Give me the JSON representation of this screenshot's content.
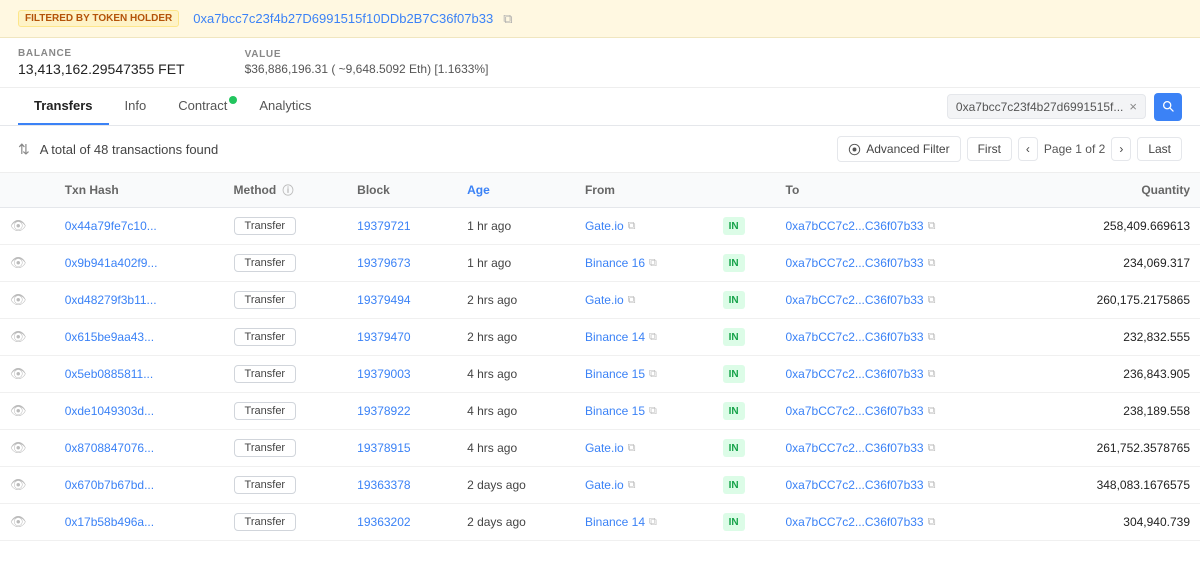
{
  "banner": {
    "tag": "FILTERED BY TOKEN HOLDER",
    "address": "0xa7bcc7c23f4b27D6991515f10DDb2B7C36f07b33",
    "address_short": "0xa7bcc7c23f4b27D6991515f10DDb2B7C36f07b33"
  },
  "stats": {
    "balance_label": "BALANCE",
    "balance_value": "13,413,162.29547355 FET",
    "value_label": "VALUE",
    "value_value": "$36,886,196.31 ( ~9,648.5092 Eth) [1.1633%]"
  },
  "tabs": [
    {
      "id": "transfers",
      "label": "Transfers",
      "active": true,
      "verified": false
    },
    {
      "id": "info",
      "label": "Info",
      "active": false,
      "verified": false
    },
    {
      "id": "contract",
      "label": "Contract",
      "active": false,
      "verified": true
    },
    {
      "id": "analytics",
      "label": "Analytics",
      "active": false,
      "verified": false
    }
  ],
  "address_pill": "0xa7bcc7c23f4b27d6991515f...",
  "filter_bar": {
    "sort_label": "A total of 48 transactions found",
    "advanced_label": "Advanced Filter",
    "first_label": "First",
    "last_label": "Last",
    "page_info": "Page 1 of 2"
  },
  "table": {
    "headers": [
      "",
      "Txn Hash",
      "Method",
      "Block",
      "Age",
      "From",
      "",
      "To",
      "Quantity"
    ],
    "rows": [
      {
        "txn": "0x44a79fe7c10...",
        "method": "Transfer",
        "block": "19379721",
        "age": "1 hr ago",
        "from": "Gate.io",
        "direction": "IN",
        "to": "0xa7bCC7c2...C36f07b33",
        "quantity": "258,409.669613"
      },
      {
        "txn": "0x9b941a402f9...",
        "method": "Transfer",
        "block": "19379673",
        "age": "1 hr ago",
        "from": "Binance 16",
        "direction": "IN",
        "to": "0xa7bCC7c2...C36f07b33",
        "quantity": "234,069.317"
      },
      {
        "txn": "0xd48279f3b11...",
        "method": "Transfer",
        "block": "19379494",
        "age": "2 hrs ago",
        "from": "Gate.io",
        "direction": "IN",
        "to": "0xa7bCC7c2...C36f07b33",
        "quantity": "260,175.2175865"
      },
      {
        "txn": "0x615be9aa43...",
        "method": "Transfer",
        "block": "19379470",
        "age": "2 hrs ago",
        "from": "Binance 14",
        "direction": "IN",
        "to": "0xa7bCC7c2...C36f07b33",
        "quantity": "232,832.555"
      },
      {
        "txn": "0x5eb0885811...",
        "method": "Transfer",
        "block": "19379003",
        "age": "4 hrs ago",
        "from": "Binance 15",
        "direction": "IN",
        "to": "0xa7bCC7c2...C36f07b33",
        "quantity": "236,843.905"
      },
      {
        "txn": "0xde1049303d...",
        "method": "Transfer",
        "block": "19378922",
        "age": "4 hrs ago",
        "from": "Binance 15",
        "direction": "IN",
        "to": "0xa7bCC7c2...C36f07b33",
        "quantity": "238,189.558"
      },
      {
        "txn": "0x8708847076...",
        "method": "Transfer",
        "block": "19378915",
        "age": "4 hrs ago",
        "from": "Gate.io",
        "direction": "IN",
        "to": "0xa7bCC7c2...C36f07b33",
        "quantity": "261,752.3578765"
      },
      {
        "txn": "0x670b7b67bd...",
        "method": "Transfer",
        "block": "19363378",
        "age": "2 days ago",
        "from": "Gate.io",
        "direction": "IN",
        "to": "0xa7bCC7c2...C36f07b33",
        "quantity": "348,083.1676575"
      },
      {
        "txn": "0x17b58b496a...",
        "method": "Transfer",
        "block": "19363202",
        "age": "2 days ago",
        "from": "Binance 14",
        "direction": "IN",
        "to": "0xa7bCC7c2...C36f07b33",
        "quantity": "304,940.739"
      }
    ]
  },
  "icons": {
    "sort": "⇅",
    "copy": "⧉",
    "eye": "👁",
    "search": "🔍",
    "chevron_left": "‹",
    "chevron_right": "›",
    "filter": "⚙",
    "info": "ⓘ",
    "close": "×"
  }
}
